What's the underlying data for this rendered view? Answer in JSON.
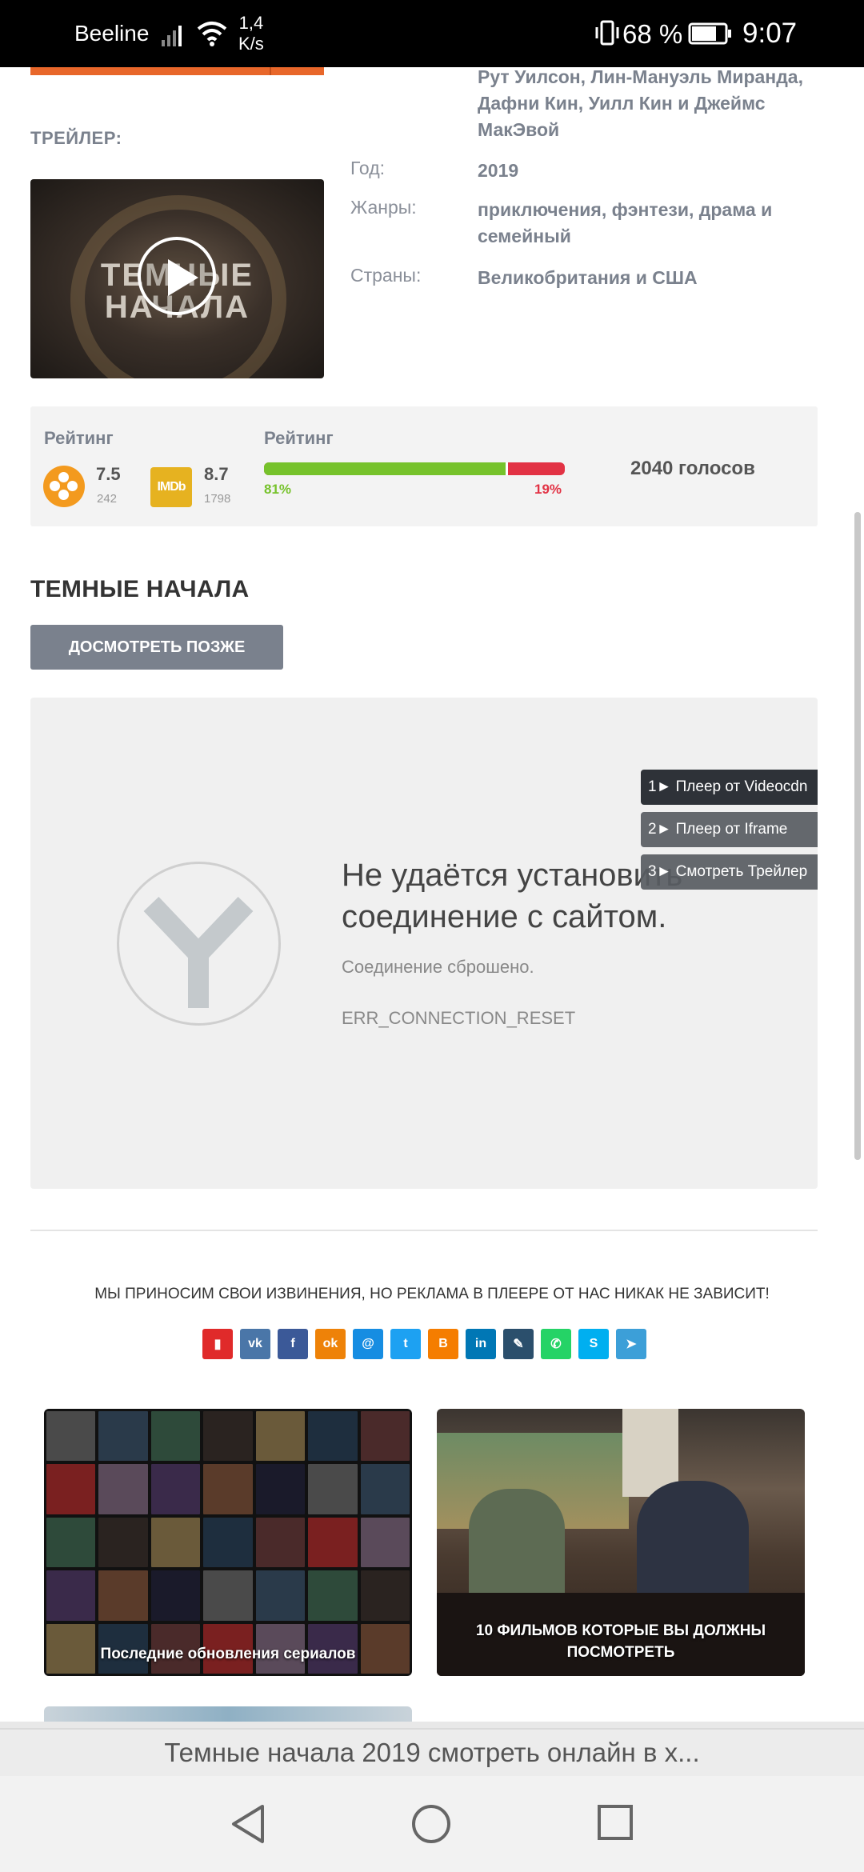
{
  "status_bar": {
    "carrier": "Beeline",
    "speed": "1,4\nK/s",
    "battery_percent": "68 %",
    "time": "9:07"
  },
  "trailer": {
    "label": "ТРЕЙЛЕР:",
    "thumb_title": "ТЕМНЫЕ НАЧАЛА"
  },
  "details": {
    "cast": {
      "names": [
        "Рут Уилсон",
        "Лин-Мануэль Миранда",
        "Дафни Кин",
        "Уилл Кин",
        "Джеймс МакЭвой"
      ],
      "text": "Рут Уилсон, Лин-Мануэль Миранда, Дафни Кин, Уилл Кин и Джеймс МакЭвой"
    },
    "year_label": "Год:",
    "year": "2019",
    "genres_label": "Жанры:",
    "genres": "приключения, фэнтези, драма и семейный",
    "countries_label": "Страны:",
    "countries": "Великобритания и США"
  },
  "rating": {
    "label_left": "Рейтинг",
    "label_right": "Рейтинг",
    "kinopoisk_score": "7.5",
    "kinopoisk_votes": "242",
    "imdb_label": "IMDb",
    "imdb_score": "8.7",
    "imdb_votes": "1798",
    "positive_pct": "81%",
    "negative_pct": "19%",
    "positive_fraction": 0.81,
    "total_votes": "2040 голосов"
  },
  "title": "ТЕМНЫЕ НАЧАЛА",
  "watch_later": "ДОСМОТРЕТЬ ПОЗЖЕ",
  "player": {
    "error_title": "Не удаётся установить соединение с сайтом.",
    "error_sub": "Соединение сброшено.",
    "error_code": "ERR_CONNECTION_RESET",
    "servers": [
      "1► Плеер от Videocdn",
      "2► Плеер от Iframe",
      "3► Смотреть Трейлер"
    ]
  },
  "apology": "МЫ ПРИНОСИМ СВОИ ИЗВИНЕНИЯ, НО РЕКЛАМА В ПЛЕЕРЕ ОТ НАС НИКАК НЕ ЗАВИСИТ!",
  "share": [
    {
      "name": "bookmark-icon",
      "color": "#e02a2a",
      "glyph": "▮"
    },
    {
      "name": "vk-icon",
      "color": "#4a76a8",
      "glyph": "vk"
    },
    {
      "name": "facebook-icon",
      "color": "#3b5998",
      "glyph": "f"
    },
    {
      "name": "odnoklassniki-icon",
      "color": "#ee8208",
      "glyph": "ok"
    },
    {
      "name": "moimir-icon",
      "color": "#168de2",
      "glyph": "@"
    },
    {
      "name": "twitter-icon",
      "color": "#1da1f2",
      "glyph": "t"
    },
    {
      "name": "blogger-icon",
      "color": "#f57d00",
      "glyph": "B"
    },
    {
      "name": "linkedin-icon",
      "color": "#0077b5",
      "glyph": "in"
    },
    {
      "name": "livejournal-icon",
      "color": "#2b4f6c",
      "glyph": "✎"
    },
    {
      "name": "whatsapp-icon",
      "color": "#25d366",
      "glyph": "✆"
    },
    {
      "name": "skype-icon",
      "color": "#00aff0",
      "glyph": "S"
    },
    {
      "name": "telegram-icon",
      "color": "#3c9fd8",
      "glyph": "➤"
    }
  ],
  "cards": [
    {
      "caption": "Последние обновления сериалов"
    },
    {
      "caption": "10 ФИЛЬМОВ КОТОРЫЕ ВЫ ДОЛЖНЫ ПОСМОТРЕТЬ"
    }
  ],
  "url_bar": {
    "text": "Темные начала 2019 смотреть онлайн в х..."
  }
}
